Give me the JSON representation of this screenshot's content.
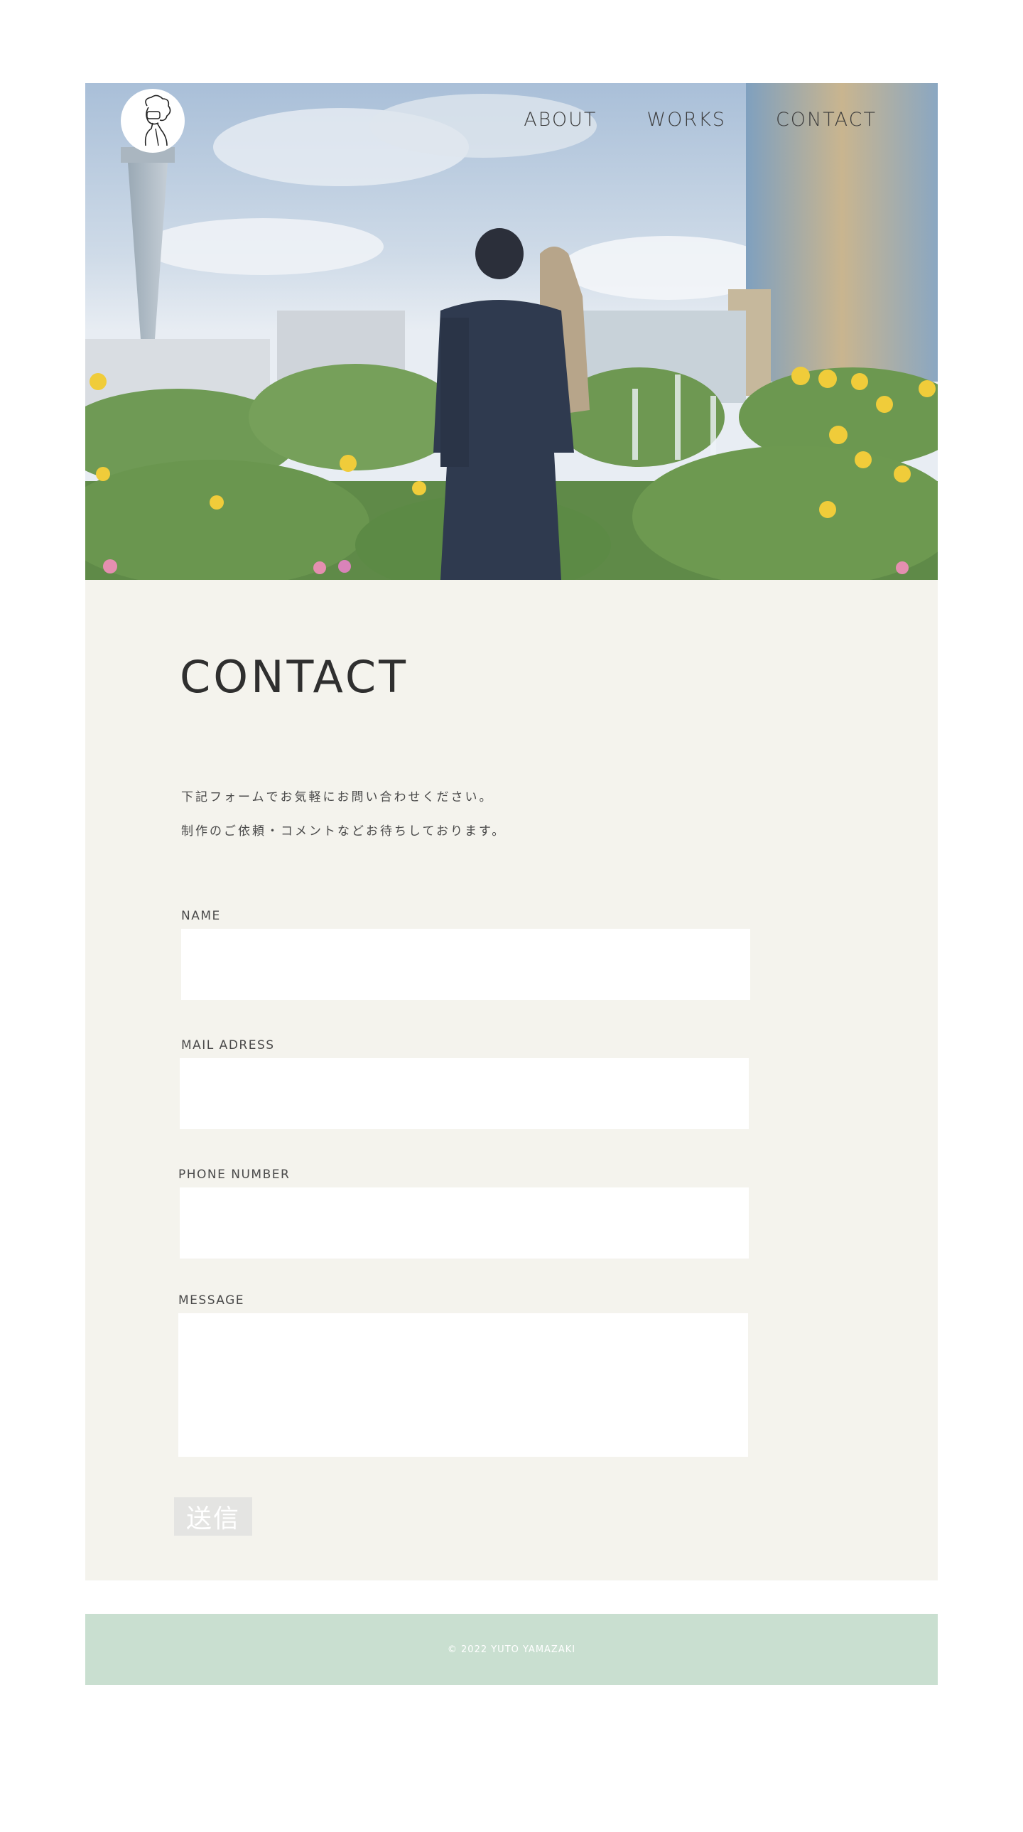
{
  "header": {
    "logo_alt": "avatar-line-drawing",
    "nav": [
      {
        "label": "ABOUT"
      },
      {
        "label": "WORKS"
      },
      {
        "label": "CONTACT"
      }
    ]
  },
  "contact": {
    "title": "CONTACT",
    "intro_lines": [
      "下記フォームでお気軽にお問い合わせください。",
      "制作のご依頼・コメントなどお待ちしております。"
    ],
    "fields": {
      "name": {
        "label": "NAME",
        "value": "",
        "placeholder": ""
      },
      "mail": {
        "label": "MAIL ADRESS",
        "value": "",
        "placeholder": ""
      },
      "phone": {
        "label": "PHONE NUMBER",
        "value": "",
        "placeholder": ""
      },
      "message": {
        "label": "MESSAGE",
        "value": "",
        "placeholder": ""
      }
    },
    "submit_label": "送信"
  },
  "footer": {
    "copyright": "© 2022 YUTO YAMAZAKI"
  },
  "colors": {
    "contact_bg": "#f4f3ed",
    "footer_bg": "#c9dfd0",
    "submit_bg": "#e4e4e2",
    "text": "#3a3a3a"
  }
}
